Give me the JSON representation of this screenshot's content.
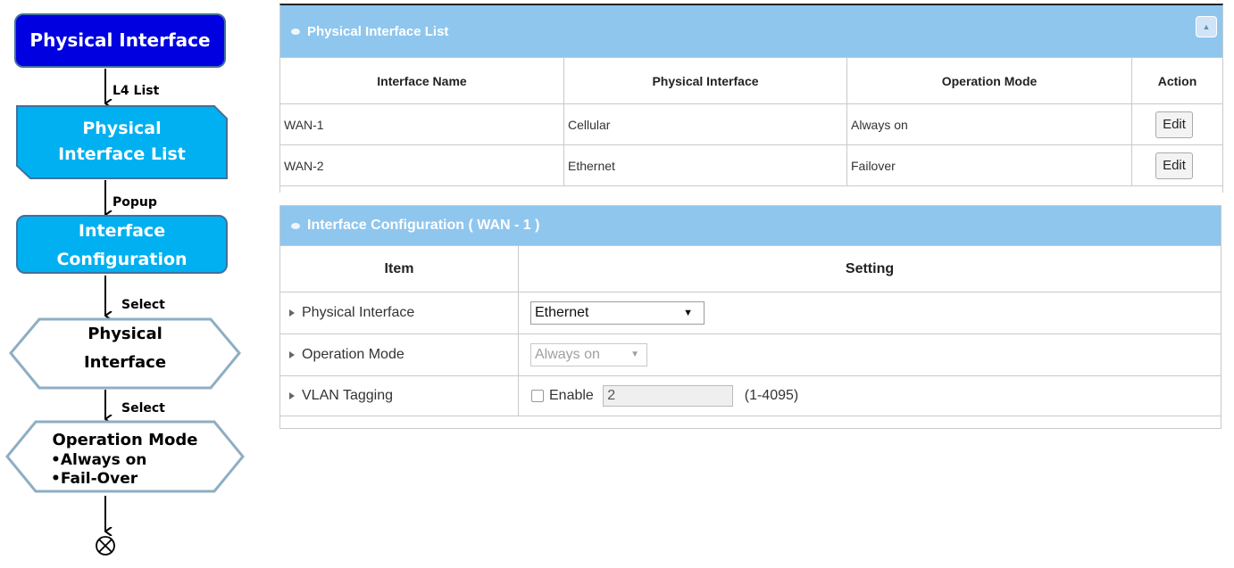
{
  "flowchart": {
    "step1": "Physical Interface",
    "label1": "L4 List",
    "step2_line1": "Physical",
    "step2_line2": "Interface List",
    "label2": "Popup",
    "step3_line1": "Interface",
    "step3_line2": "Configuration",
    "label3": "Select",
    "step4_line1": "Physical",
    "step4_line2": "Interface",
    "label4": "Select",
    "step5_title": "Operation Mode",
    "step5_items": [
      "•Always on",
      "•Fail-Over"
    ],
    "end_icon": "end-circle-x-icon"
  },
  "interface_list": {
    "title": "Physical Interface List",
    "columns": [
      "Interface Name",
      "Physical Interface",
      "Operation Mode",
      "Action"
    ],
    "rows": [
      {
        "name": "WAN-1",
        "physical": "Cellular",
        "mode": "Always on",
        "action": "Edit"
      },
      {
        "name": "WAN-2",
        "physical": "Ethernet",
        "mode": "Failover",
        "action": "Edit"
      }
    ],
    "header_color": "#8fc6ee"
  },
  "config": {
    "title": "Interface Configuration ( WAN - 1 )",
    "col_item": "Item",
    "col_setting": "Setting",
    "physical_label": "Physical Interface",
    "physical_value": "Ethernet",
    "mode_label": "Operation Mode",
    "mode_value": "Always on",
    "vlan_label": "VLAN Tagging",
    "vlan_enable": "Enable",
    "vlan_value": "2",
    "vlan_range": "(1-4095)"
  },
  "colors": {
    "flow_dark_blue": "#0000e0",
    "flow_light_blue": "#00b0f0",
    "flow_border": "#41719c"
  }
}
